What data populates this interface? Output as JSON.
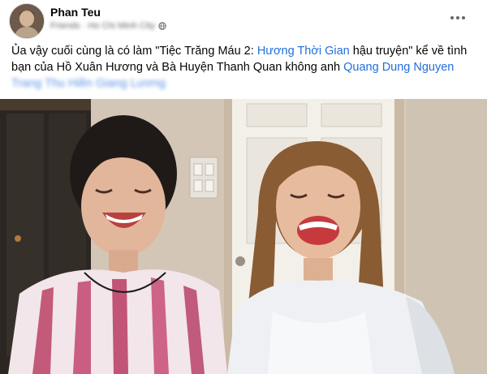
{
  "post": {
    "author": "Phan Teu",
    "meta_text": "Friends · Ho Chi Minh City",
    "text_intro": "Ủa vậy cuối cùng là có làm \"Tiệc Trăng Máu 2: ",
    "text_link_1": "Hương Thời Gian",
    "text_mid": " hậu truyện\" kể về tình bạn của Hồ Xuân Hương và Bà Huyện Thanh Quan không anh ",
    "text_link_2": "Quang Dung Nguyen",
    "text_link_3": "Trang Thu Hiền Giang Lương",
    "icons": {
      "more": "more-options-icon",
      "globe": "globe-icon"
    }
  },
  "colors": {
    "link": "#216fdb",
    "meta": "#65676b",
    "text": "#050505"
  }
}
